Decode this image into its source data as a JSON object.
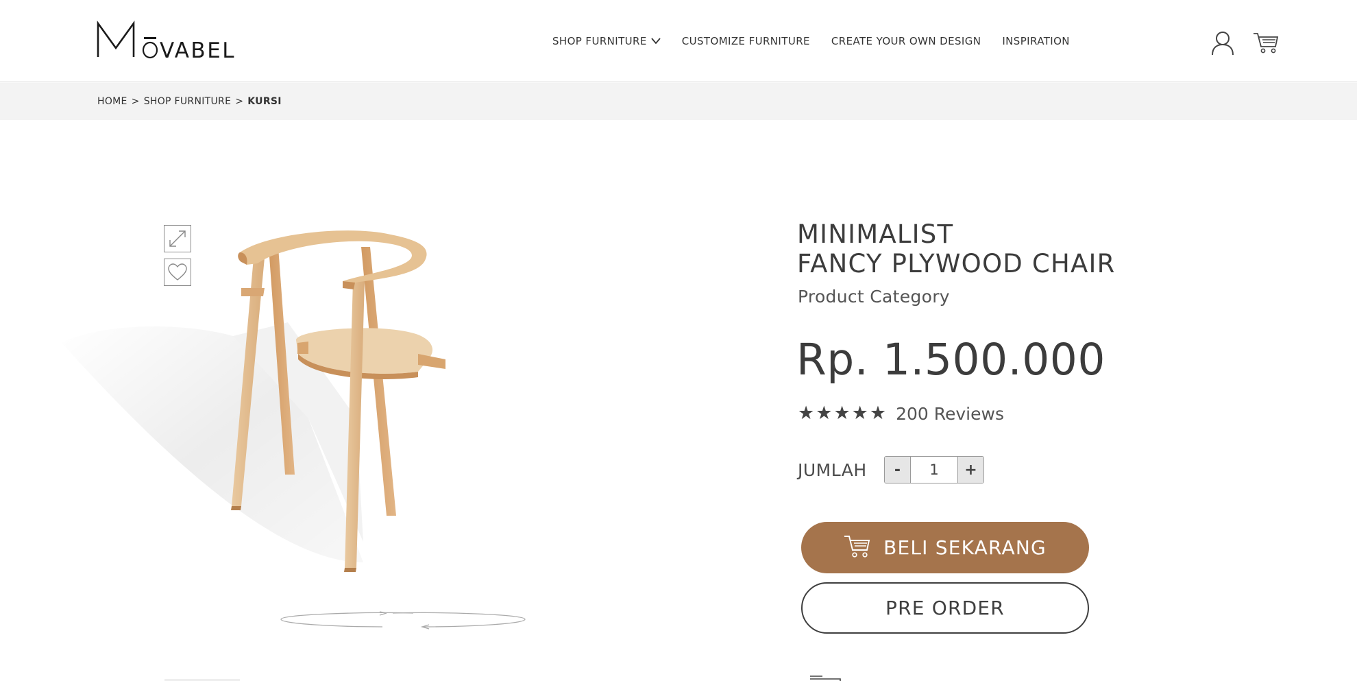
{
  "brand": {
    "name": "MOVABEL",
    "logo_icon": "movabel-logo"
  },
  "nav": {
    "items": [
      {
        "label": "SHOP FURNITURE",
        "has_dropdown": true
      },
      {
        "label": "CUSTOMIZE FURNITURE",
        "has_dropdown": false
      },
      {
        "label": "CREATE YOUR OWN DESIGN",
        "has_dropdown": false
      },
      {
        "label": "INSPIRATION",
        "has_dropdown": false
      }
    ],
    "icons": [
      "user-icon",
      "cart-icon"
    ]
  },
  "breadcrumb": {
    "items": [
      "HOME",
      "SHOP FURNITURE"
    ],
    "separator": ">",
    "current": "KURSI"
  },
  "product": {
    "title_line1": "MINIMALIST",
    "title_line2": "FANCY PLYWOOD CHAIR",
    "category": "Product Category",
    "price": "Rp. 1.500.000",
    "rating": 5,
    "reviews": "200 Reviews",
    "image_icon": "wooden-chair-image",
    "tools": [
      "expand-icon",
      "heart-icon"
    ],
    "rotate_icon": "rotate-360-icon"
  },
  "quantity": {
    "label": "JUMLAH",
    "minus": "-",
    "plus": "+",
    "value": "1"
  },
  "actions": {
    "buy_label": "BELI SEKARANG",
    "preorder_label": "PRE ORDER"
  },
  "colors": {
    "accent": "#a5744c",
    "text": "#3f3f3f",
    "breadcrumb_bg": "#f3f3f3"
  }
}
